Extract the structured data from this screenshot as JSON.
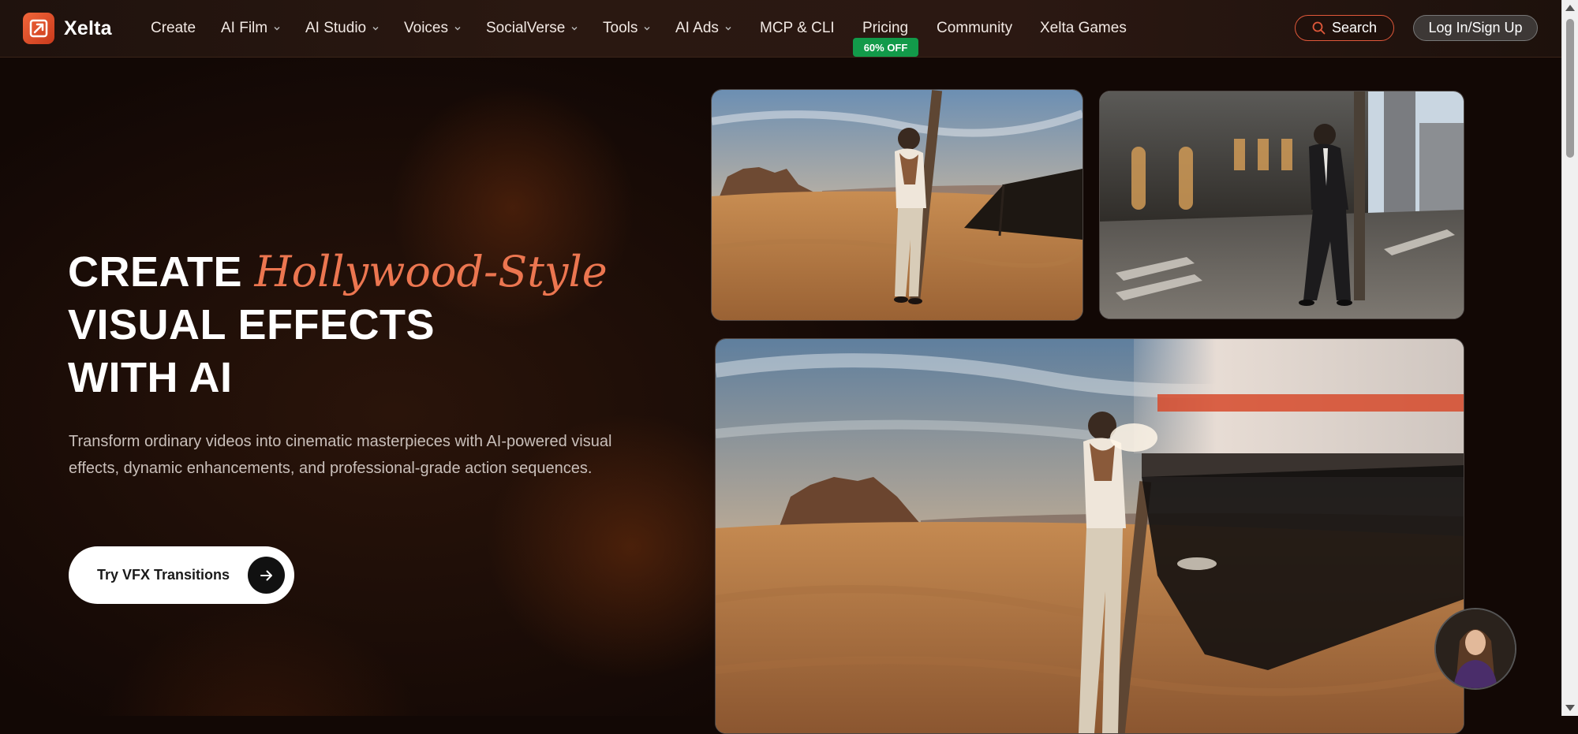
{
  "brand": {
    "name": "Xelta"
  },
  "nav": {
    "items": [
      {
        "label": "Create",
        "dropdown": false
      },
      {
        "label": "AI Film",
        "dropdown": true
      },
      {
        "label": "AI Studio",
        "dropdown": true
      },
      {
        "label": "Voices",
        "dropdown": true
      },
      {
        "label": "SocialVerse",
        "dropdown": true
      },
      {
        "label": "Tools",
        "dropdown": true
      },
      {
        "label": "AI Ads",
        "dropdown": true
      },
      {
        "label": "MCP & CLI",
        "dropdown": false
      },
      {
        "label": "Pricing",
        "dropdown": false
      },
      {
        "label": "Community",
        "dropdown": false
      },
      {
        "label": "Xelta Games",
        "dropdown": false
      }
    ],
    "pricing_badge": "60% OFF"
  },
  "header": {
    "search_label": "Search",
    "login_label": "Log In/Sign Up"
  },
  "hero": {
    "line1_prefix": "CREATE",
    "line1_accent": "Hollywood-Style",
    "line2": "VISUAL EFFECTS",
    "line3": "WITH AI",
    "description": "Transform ordinary videos into cinematic masterpieces with AI-powered visual effects, dynamic enhancements, and professional-grade action sequences.",
    "cta_label": "Try VFX Transitions"
  },
  "colors": {
    "accent": "#ec7650",
    "promo_green": "#129a4a",
    "search_border": "#e0583a",
    "background": "#120805"
  },
  "icons": {
    "logo": "xelta-logo-icon",
    "search": "search-icon",
    "chevron": "chevron-down-icon",
    "cta": "arrow-right-icon"
  }
}
